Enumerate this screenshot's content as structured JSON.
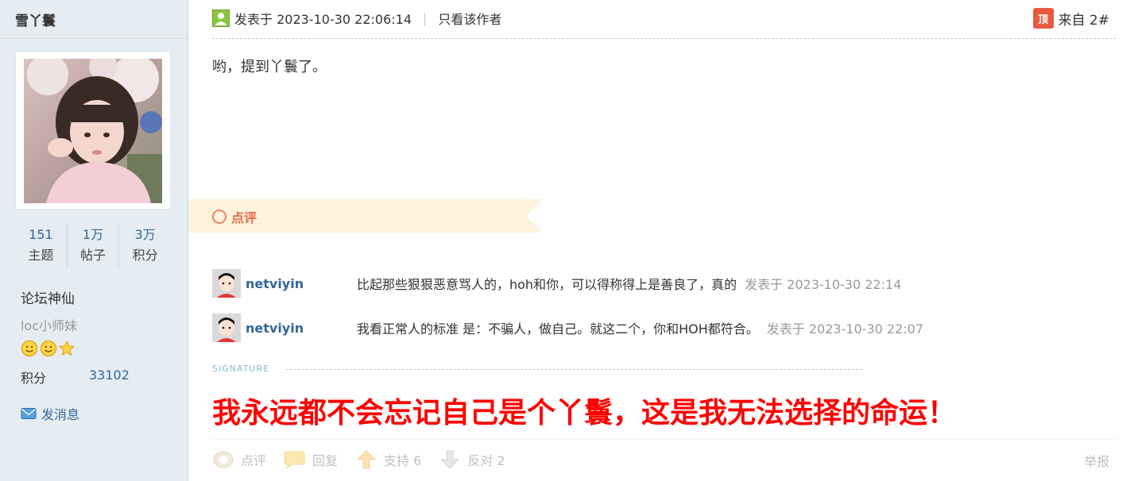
{
  "author": {
    "name": "雪丫鬟",
    "stats": [
      {
        "value": "151",
        "label": "主题"
      },
      {
        "value": "1万",
        "label": "帖子"
      },
      {
        "value": "3万",
        "label": "积分"
      }
    ],
    "rank": "论坛神仙",
    "group": "loc小师妹",
    "credit_label": "积分",
    "credit_value": "33102",
    "pm_label": "发消息"
  },
  "post": {
    "posted": "发表于 2023-10-30 22:06:14",
    "only_author": "只看该作者",
    "top_badge": "顶",
    "floor": "来自 2#",
    "content": "哟，提到丫鬟了。"
  },
  "dianping": {
    "label": "点评",
    "comments": [
      {
        "user": "netviyin",
        "text": "比起那些狠狠恶意骂人的，hoh和你，可以得称得上是善良了，真的",
        "time": "发表于 2023-10-30 22:14"
      },
      {
        "user": "netviyin",
        "text": "我看正常人的标准 是：不骗人，做自己。就这二个，你和HOH都符合。",
        "time": "发表于 2023-10-30 22:07"
      }
    ]
  },
  "signature": {
    "label": "SIGNATURE",
    "text": "我永远都不会忘记自己是个丫鬟，这是我无法选择的命运！"
  },
  "footer": {
    "dianping": "点评",
    "reply": "回复",
    "support": "支持 6",
    "oppose": "反对 2",
    "report": "举报"
  },
  "colors": {
    "side_bg": "#e5edf2",
    "link": "#336699",
    "signature": "#ff0000",
    "dianping": "#e6684a"
  }
}
